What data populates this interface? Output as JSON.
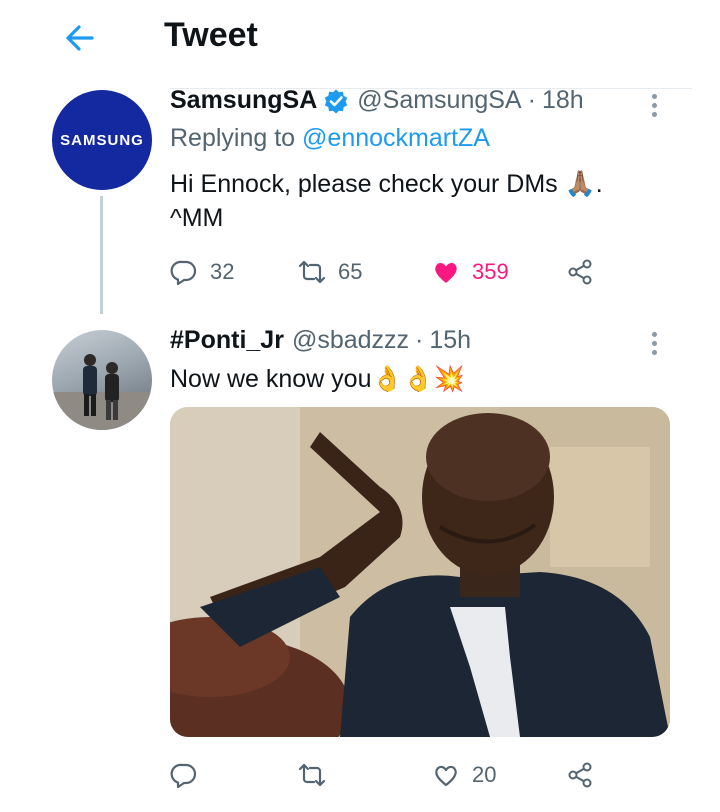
{
  "header": {
    "title": "Tweet"
  },
  "tweets": [
    {
      "avatar_text": "SAMSUNG",
      "name": "SamsungSA",
      "handle": "@SamsungSA",
      "separator": "·",
      "time": "18h",
      "replying_prefix": "Replying to",
      "replying_to": "@ennockmartZA",
      "text_line1": "Hi Ennock, please check your DMs 🙏🏽.",
      "text_line2": "^MM",
      "replies": "32",
      "retweets": "65",
      "likes": "359",
      "liked": true
    },
    {
      "name": "#Ponti_Jr",
      "handle": "@sbadzzz",
      "separator": "·",
      "time": "15h",
      "text": "Now we know you👌👌💥",
      "replies": "",
      "retweets": "",
      "likes": "20"
    }
  ],
  "colors": {
    "accent": "#1d9bf0",
    "like": "#f91880",
    "samsung_blue": "#1428a0"
  }
}
